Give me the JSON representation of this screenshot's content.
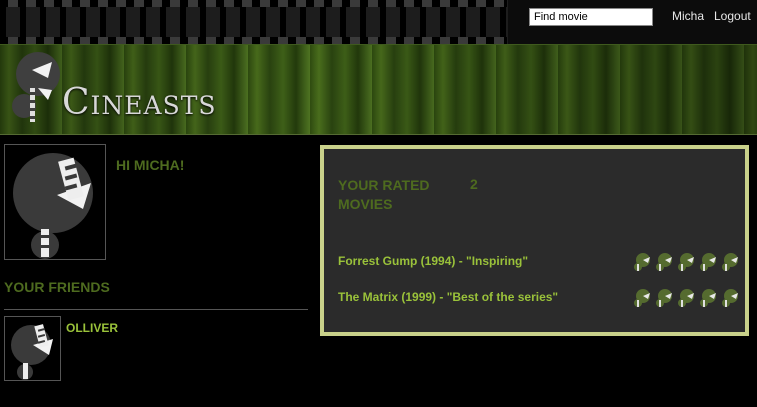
{
  "header": {
    "search": {
      "placeholder": "Find movie",
      "value": "Find movie"
    },
    "user_name": "Micha",
    "logout_label": "Logout"
  },
  "site": {
    "name": "Cineasts"
  },
  "profile": {
    "greeting": "HI MICHA!",
    "friends_heading": "YOUR FRIENDS",
    "friends": [
      {
        "name": "OLLIVER"
      }
    ]
  },
  "rated": {
    "title": "YOUR RATED MOVIES",
    "count": "2",
    "movies": [
      {
        "label": "Forrest Gump (1994) - \"Inspiring\"",
        "rating": 5,
        "max": 5
      },
      {
        "label": "The Matrix (1999) - \"Best of the series\"",
        "rating": 5,
        "max": 5
      }
    ]
  },
  "icons": {
    "rating": "film-reel-head-icon",
    "logo": "cineasts-mascot-icon"
  },
  "colors": {
    "accent": "#9ac23a",
    "heading": "#4e6b1f",
    "box_border": "#c9d18a",
    "box_bg": "#2b2b2b"
  }
}
